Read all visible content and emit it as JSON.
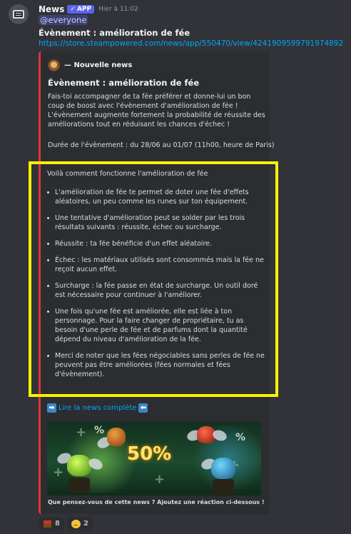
{
  "message": {
    "author": "News",
    "badge": "APP",
    "badge_check": "✓",
    "timestamp": "Hier à 11:02",
    "mention": "@everyone",
    "title": "Évènement : amélioration de fée",
    "link": "https://store.steampowered.com/news/app/550470/view/4241909599791974892"
  },
  "embed": {
    "author": "— Nouvelle news",
    "title": "Évènement : amélioration de fée",
    "description": "Fais-toi accompagner de ta fée préférer et donne-lui un bon coup de boost avec l'évènement d'amélioration de fée ! L'évènement augmente fortement la probabilité de réussite des améliorations tout en réduisant les chances d'échec !",
    "duration": "Durée de l'évènement : du 28/06 au 01/07 (11h00, heure de Paris)",
    "how_intro": "Voilà comment fonctionne l'amélioration de fée",
    "how_items": [
      "L'amélioration de fée te permet de doter une fée d'effets aléatoires, un peu comme les runes sur ton équipement.",
      "Une tentative d'amélioration peut se solder par les trois résultats suivants : réussite, échec ou surcharge.",
      "Réussite : ta fée bénéficie d'un effet aléatoire.",
      "Échec : les matériaux utilisés sont consommés mais la fée ne reçoit aucun effet.",
      "Surcharge : la fée passe en état de surcharge. Un outil doré est nécessaire pour continuer à l'améliorer.",
      "Une fois qu'une fée est améliorée, elle est liée à ton personnage. Pour la faire changer de propriétaire, tu as besoin d'une perle de fée et de parfums dont la quantité dépend du niveau d'amélioration de la fée.",
      "Merci de noter que les fées négociables sans perles de fée ne peuvent pas être améliorées (fées normales et fées d'évènement)."
    ],
    "read_more": "Lire la news complète",
    "read_more_arrow_left": "➡",
    "read_more_arrow_right": "⬅",
    "banner_percent": "50%",
    "banner_small_percent": "%",
    "footer": "Que pensez-vous de cette news ? Ajoutez une réaction ci-dessous !"
  },
  "reactions": [
    {
      "emoji": "treasure-chest",
      "count": "8"
    },
    {
      "emoji": "sad-face",
      "count": "2"
    }
  ],
  "colors": {
    "background": "#313338",
    "embed_background": "#2b2d31",
    "embed_accent": "#da373c",
    "link": "#00a8fc",
    "highlight_box": "#fff200",
    "app_badge": "#5865f2"
  }
}
